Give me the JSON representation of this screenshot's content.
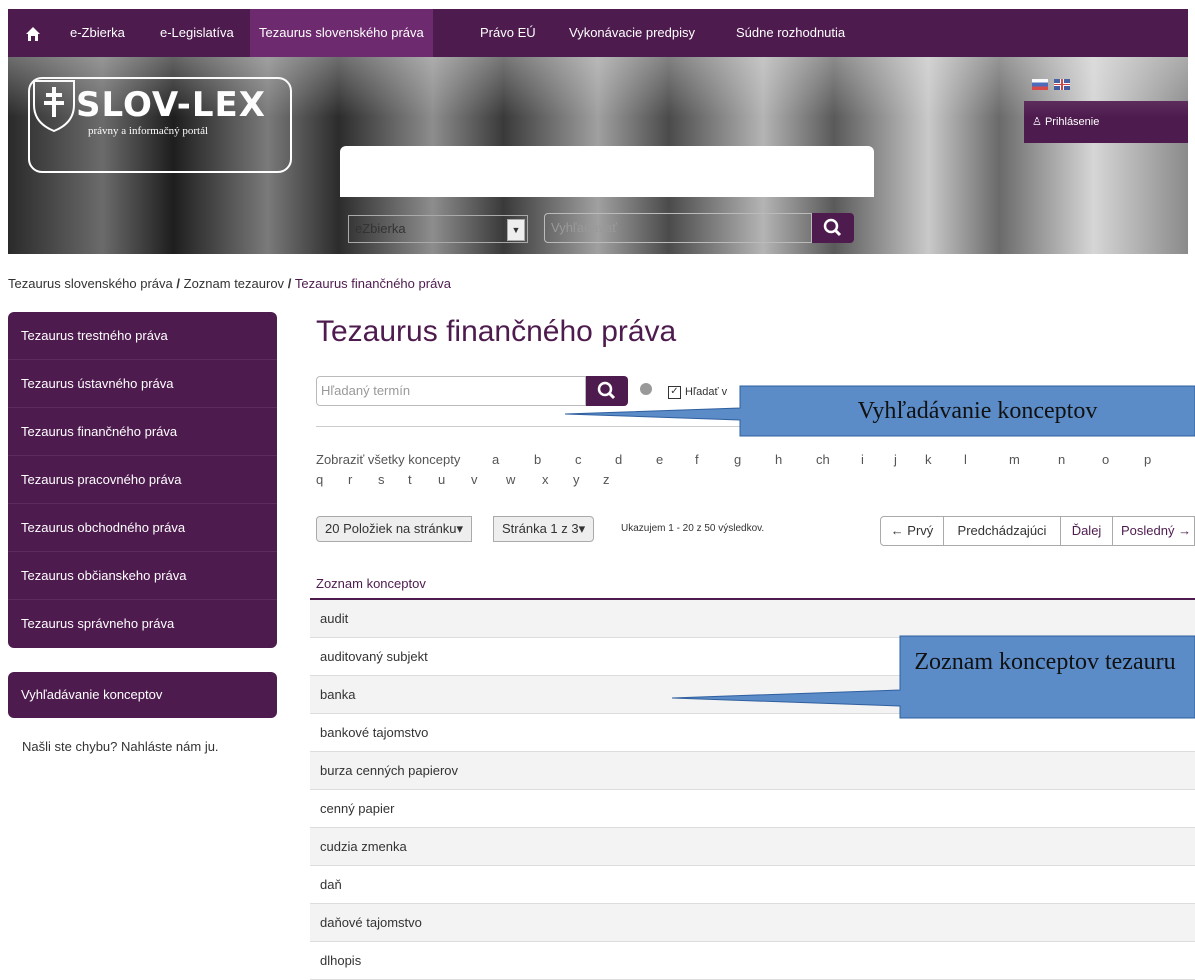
{
  "nav": {
    "items": [
      "e-Zbierka",
      "e-Legislatíva",
      "Tezaurus slovenského práva",
      "Právo EÚ",
      "Vykonávacie predpisy",
      "Súdne rozhodnutia"
    ],
    "active_index": 2
  },
  "header": {
    "logo_title": "SLOV-LEX",
    "logo_subtitle": "právny a informačný portál",
    "login_label": "Prihlásenie",
    "collection_select": "eZbierka",
    "search_placeholder": "Vyhľadávať"
  },
  "breadcrumb": {
    "parts": [
      "Tezaurus slovenského práva",
      "Zoznam tezaurov",
      "Tezaurus finančného práva"
    ]
  },
  "sidebar": {
    "items": [
      {
        "label": "Tezaurus trestného práva"
      },
      {
        "label": "Tezaurus ústavného práva"
      },
      {
        "label": "Tezaurus finančného práva"
      },
      {
        "label": "Tezaurus pracovného práva"
      },
      {
        "label": "Tezaurus obchodného práva"
      },
      {
        "label": "Tezaurus občianskeho práva"
      },
      {
        "label": "Tezaurus správneho práva"
      }
    ],
    "search_concepts": "Vyhľadávanie konceptov",
    "report_text": "Našli ste chybu? Nahláste nám ju."
  },
  "main": {
    "title": "Tezaurus finančného práva",
    "term_placeholder": "Hľadaný termín",
    "search_in_label": "Hľadať v",
    "letters": [
      "Zobraziť všetky koncepty",
      "a",
      "b",
      "c",
      "d",
      "e",
      "f",
      "g",
      "h",
      "ch",
      "i",
      "j",
      "k",
      "l",
      "m",
      "n",
      "o",
      "p",
      "q",
      "r",
      "s",
      "t",
      "u",
      "v",
      "w",
      "x",
      "y",
      "z"
    ],
    "per_page": "20 Položiek na stránku",
    "page_info": "Stránka 1 z 3",
    "shown_info": "Ukazujem 1 - 20 z 50 výsledkov.",
    "pager": {
      "first": "← Prvý",
      "prev": "Predchádzajúci",
      "next": "Ďalej",
      "last": "Posledný →"
    },
    "list_header": "Zoznam konceptov",
    "concepts": [
      "audit",
      "auditovaný subjekt",
      "banka",
      "bankové tajomstvo",
      "burza cenných papierov",
      "cenný papier",
      "cudzia zmenka",
      "daň",
      "daňové tajomstvo",
      "dlhopis"
    ]
  },
  "callouts": {
    "search": "Vyhľadávanie konceptov",
    "list": "Zoznam konceptov tezauru"
  },
  "colors": {
    "primary": "#4e1b4e",
    "callout": "#5b8cc8"
  }
}
